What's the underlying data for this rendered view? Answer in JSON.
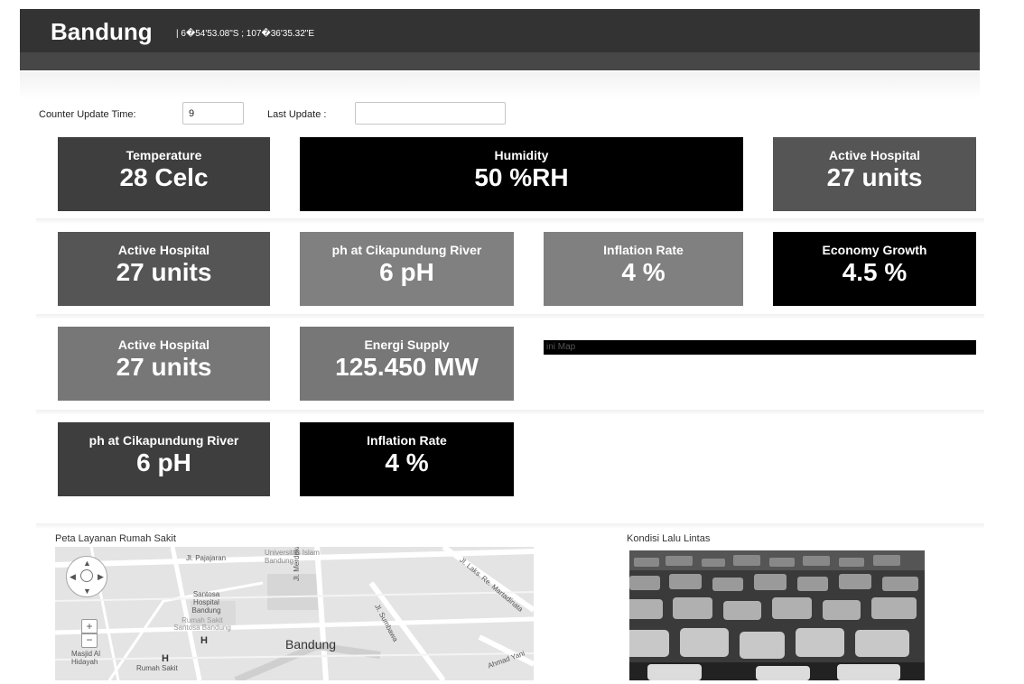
{
  "header": {
    "title": "Bandung",
    "coordinates": "| 6�54'53.08\"S ; 107�36'35.32\"E"
  },
  "controls": {
    "counter_label": "Counter Update Time:",
    "counter_value": "9",
    "last_update_label": "Last Update :",
    "last_update_value": ""
  },
  "tiles": [
    {
      "label": "Temperature",
      "value": "28 Celc"
    },
    {
      "label": "Humidity",
      "value": "50 %RH"
    },
    {
      "label": "Active Hospital",
      "value": "27 units"
    },
    {
      "label": "Active Hospital",
      "value": "27 units"
    },
    {
      "label": "ph at Cikapundung River",
      "value": "6 pH"
    },
    {
      "label": "Inflation Rate",
      "value": "4 %"
    },
    {
      "label": "Economy Growth",
      "value": "4.5 %"
    },
    {
      "label": "Active Hospital",
      "value": "27 units"
    },
    {
      "label": "Energi Supply",
      "value": "125.450 MW"
    },
    {
      "label": "ph at Cikapundung River",
      "value": "6 pH"
    },
    {
      "label": "Inflation Rate",
      "value": "4 %"
    }
  ],
  "mini_map_label": "ini Map",
  "hospital_map": {
    "title": "Peta Layanan Rumah Sakit",
    "labels": {
      "pajajaran": "Jl. Pajajaran",
      "unisba": "Universitas Islam Bandung",
      "santosa": "Santosa Hospital Bandung",
      "rs_santosa": "Rumah Sakit Santosa Bandung",
      "merdeka": "Jl. Merdeka",
      "sumbawa": "Jl. Sumbawa",
      "laks": "Jl. Laks. Re. Martadinata",
      "masjid": "Masjid Al Hidayah",
      "rs_kebon": "Rumah Sakit",
      "city": "Bandung",
      "yani": "Ahmad Yani",
      "h_marker": "H"
    }
  },
  "traffic": {
    "title": "Kondisi Lalu Lintas"
  }
}
